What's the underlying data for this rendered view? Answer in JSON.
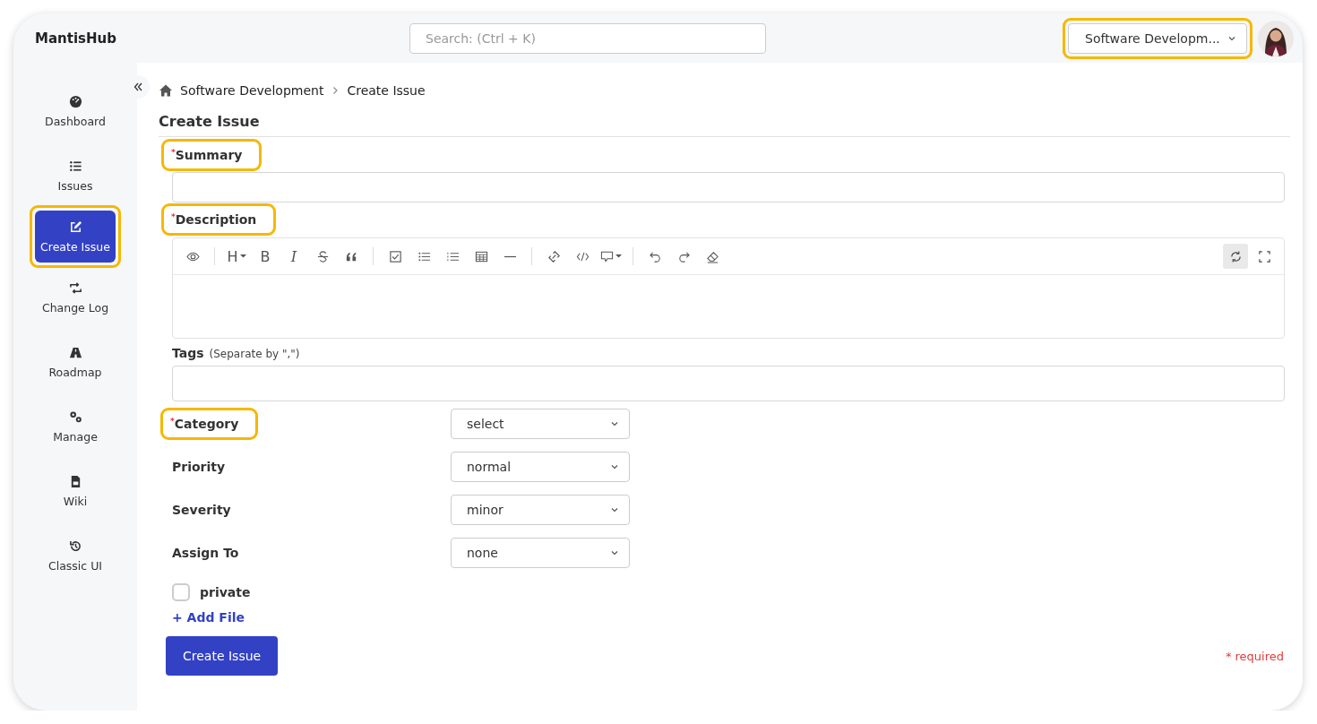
{
  "app": {
    "title": "MantisHub"
  },
  "search": {
    "placeholder": "Search: (Ctrl + K)"
  },
  "project_selector": {
    "value": "Software Developm...",
    "highlighted": true
  },
  "sidebar": {
    "items": [
      {
        "label": "Dashboard",
        "selected": false,
        "highlighted": false
      },
      {
        "label": "Issues",
        "selected": false,
        "highlighted": false
      },
      {
        "label": "Create Issue",
        "selected": true,
        "highlighted": true
      },
      {
        "label": "Change Log",
        "selected": false,
        "highlighted": false
      },
      {
        "label": "Roadmap",
        "selected": false,
        "highlighted": false
      },
      {
        "label": "Manage",
        "selected": false,
        "highlighted": false
      },
      {
        "label": "Wiki",
        "selected": false,
        "highlighted": false
      },
      {
        "label": "Classic UI",
        "selected": false,
        "highlighted": false
      }
    ]
  },
  "breadcrumb": [
    "Software Development",
    "Create Issue"
  ],
  "page_title": "Create Issue",
  "summary": {
    "label": "$^{*}$Summary",
    "highlighted": true
  },
  "description": {
    "label": "$^{*}$Description",
    "highlighted": true,
    "toolbar": [
      {
        "kind": "icon"
      },
      {
        "kind": "separator"
      },
      {
        "kind": "glyph",
        "label": "H",
        "dropdown": true
      },
      {
        "kind": "glyph",
        "label": "B"
      },
      {
        "kind": "italic_glyph",
        "label": "I"
      },
      {
        "kind": "icon"
      },
      {
        "kind": "icon"
      },
      {
        "kind": "separator"
      },
      {
        "kind": "icon"
      },
      {
        "kind": "icon"
      },
      {
        "kind": "icon"
      },
      {
        "kind": "icon"
      },
      {
        "kind": "icon"
      },
      {
        "kind": "separator"
      },
      {
        "kind": "icon"
      },
      {
        "kind": "icon"
      },
      {
        "kind": "icon",
        "dropdown": true
      },
      {
        "kind": "separator"
      },
      {
        "kind": "icon"
      },
      {
        "kind": "icon"
      },
      {
        "kind": "icon"
      }
    ],
    "toolbar_right": [
      {
        "kind": "icon",
        "active": true
      },
      {
        "kind": "icon",
        "active": false
      }
    ]
  },
  "tags": {
    "label": "Tags",
    "hint": "(Separate by \",\")"
  },
  "selects": [
    {
      "label": "$^{*}$Category",
      "value": "select",
      "highlighted": true
    },
    {
      "label": "Priority",
      "value": "normal",
      "highlighted": false
    },
    {
      "label": "Severity",
      "value": "minor",
      "highlighted": false
    },
    {
      "label": "Assign To",
      "value": "none",
      "highlighted": false
    }
  ],
  "private": {
    "label": "private",
    "checked": false
  },
  "add_file": "+ Add File",
  "submit": "Create Issue",
  "required_note": "* required"
}
